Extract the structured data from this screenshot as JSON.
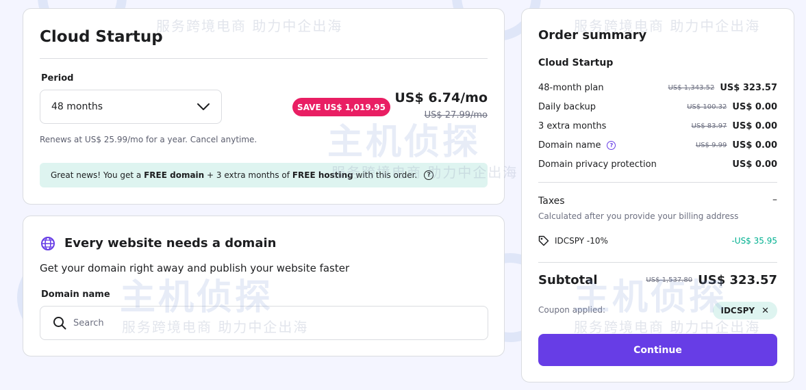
{
  "plan": {
    "title": "Cloud Startup",
    "period_label": "Period",
    "period_value": "48 months",
    "save_badge": "SAVE US$ 1,019.95",
    "price": "US$ 6.74/mo",
    "old_price": "US$ 27.99/mo",
    "renews": "Renews at US$ 25.99/mo for a year. Cancel anytime.",
    "promo": {
      "t1": "Great news! You get a ",
      "b1": "FREE domain",
      "t2": " + 3 extra months of ",
      "b2": "FREE hosting",
      "t3": " with this order."
    }
  },
  "domain": {
    "title": "Every website needs a domain",
    "subtitle": "Get your domain right away and publish your website faster",
    "label": "Domain name",
    "search_placeholder": "Search"
  },
  "summary": {
    "title": "Order summary",
    "plan_name": "Cloud Startup",
    "lines": [
      {
        "label": "48-month plan",
        "old": "US$ 1,343.52",
        "amount": "US$ 323.57"
      },
      {
        "label": "Daily backup",
        "old": "US$ 100.32",
        "amount": "US$ 0.00"
      },
      {
        "label": "3 extra months",
        "old": "US$ 83.97",
        "amount": "US$ 0.00"
      },
      {
        "label": "Domain name",
        "old": "US$ 9.99",
        "amount": "US$ 0.00"
      },
      {
        "label": "Domain privacy protection",
        "old": "",
        "amount": "US$ 0.00"
      }
    ],
    "taxes_label": "Taxes",
    "taxes_value": "–",
    "taxes_note": "Calculated after you provide your billing address",
    "coupon_code_line": "IDCSPY -10%",
    "coupon_discount": "-US$ 35.95",
    "subtotal_label": "Subtotal",
    "subtotal_old": "US$ 1,537.80",
    "subtotal": "US$ 323.57",
    "coupon_applied_label": "Coupon applied:",
    "coupon_chip": "IDCSPY",
    "continue_label": "Continue"
  },
  "watermark": {
    "small": "服务跨境电商 助力中企出海",
    "large": "主机侦探"
  },
  "colors": {
    "accent": "#673de6",
    "save_badge": "#e91e63",
    "promo_bg": "#def4f0",
    "discount_green": "#00b090"
  },
  "icons": [
    "chevron-down-icon",
    "help-icon",
    "globe-icon",
    "search-icon",
    "tag-icon",
    "close-icon"
  ]
}
